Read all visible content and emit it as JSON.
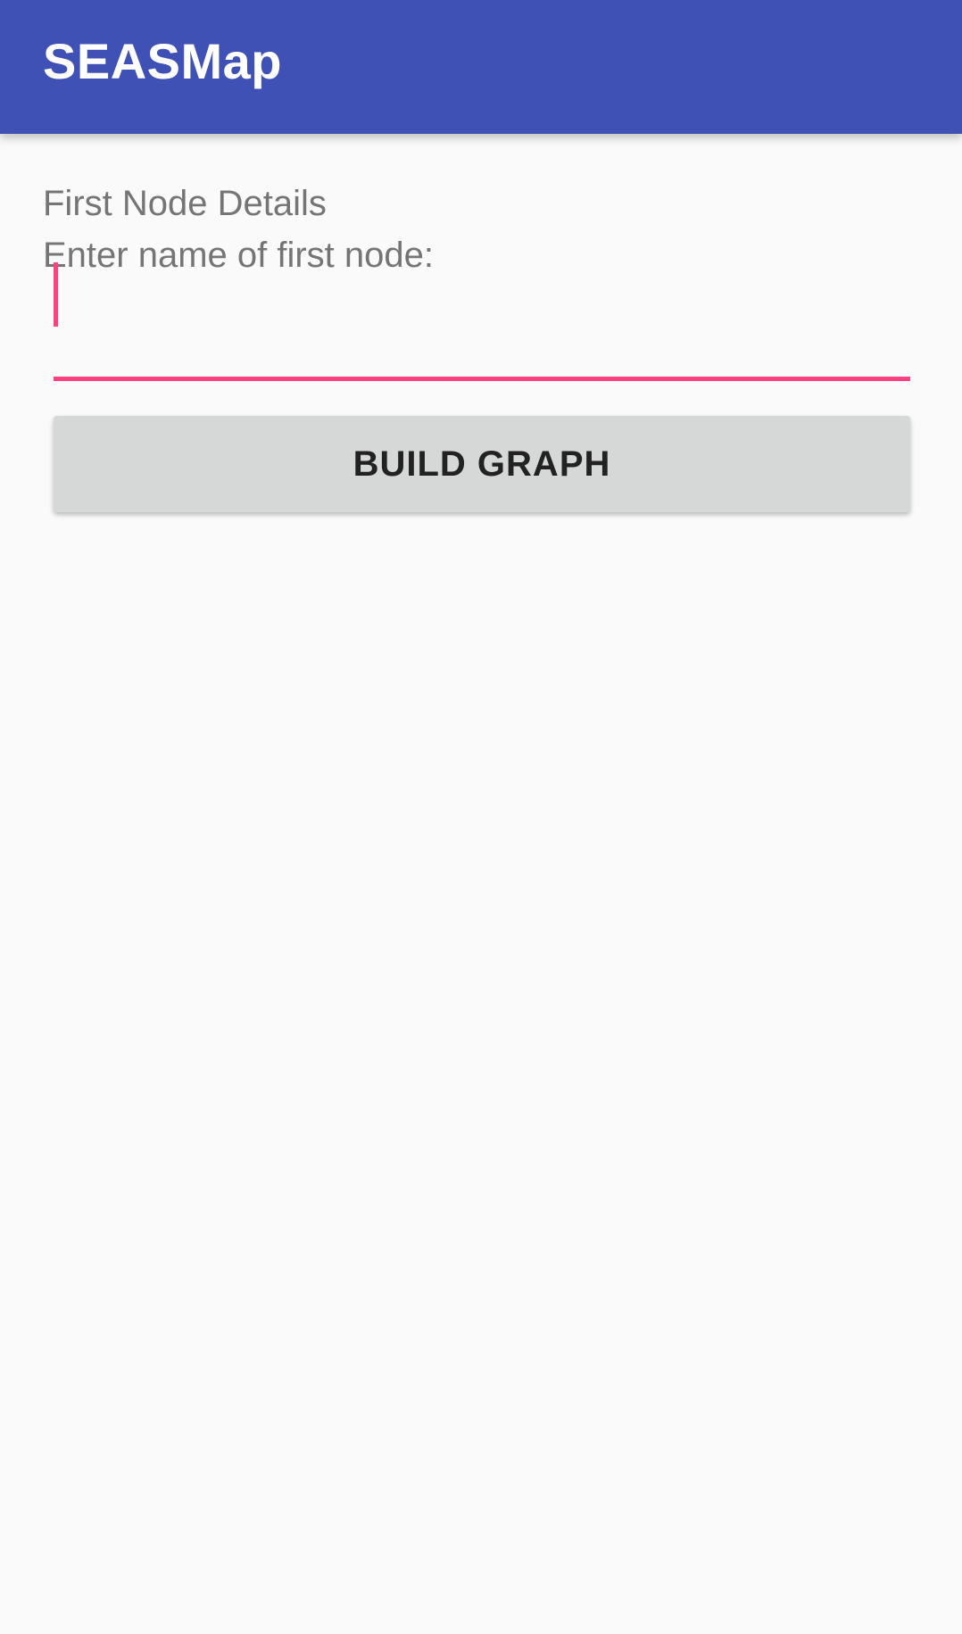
{
  "app_bar": {
    "title": "SEASMap",
    "background_color": "#3f51b5"
  },
  "form": {
    "section_title": "First Node Details",
    "node_name_label": "Enter name of first node:",
    "node_name_value": "",
    "node_name_placeholder": "",
    "accent_color": "#ff4081",
    "build_button_label": "BUILD GRAPH"
  }
}
